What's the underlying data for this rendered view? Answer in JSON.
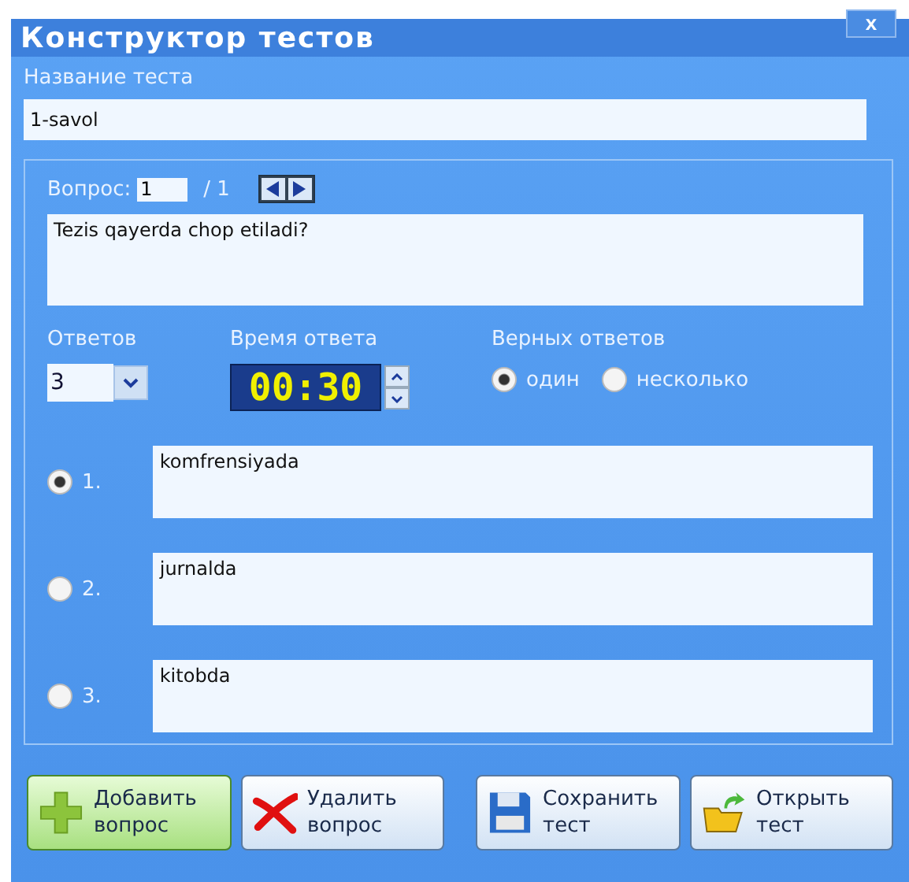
{
  "window": {
    "title": "Конструктор тестов",
    "close": "x"
  },
  "test_name": {
    "label": "Название теста",
    "value": "1-savol"
  },
  "question": {
    "label": "Вопрос:",
    "number": "1",
    "total": "/ 1",
    "text": "Tezis qayerda chop etiladi?"
  },
  "answers_count": {
    "label": "Ответов",
    "value": "3"
  },
  "answer_time": {
    "label": "Время ответа",
    "value": "00:30"
  },
  "correct_answers": {
    "label": "Верных ответов",
    "options": [
      {
        "label": "один",
        "selected": true
      },
      {
        "label": "несколько",
        "selected": false
      }
    ]
  },
  "answers": [
    {
      "number": "1.",
      "text": "komfrensiyada",
      "selected": true
    },
    {
      "number": "2.",
      "text": "jurnalda",
      "selected": false
    },
    {
      "number": "3.",
      "text": "kitobda",
      "selected": false
    }
  ],
  "buttons": [
    {
      "kind": "add",
      "label": "Добавить вопрос",
      "highlighted": true
    },
    {
      "kind": "delete",
      "label": "Удалить вопрос",
      "highlighted": false
    },
    {
      "kind": "save",
      "label": "Сохранить тест",
      "highlighted": false
    },
    {
      "kind": "open",
      "label": "Открыть тест",
      "highlighted": false
    }
  ]
}
